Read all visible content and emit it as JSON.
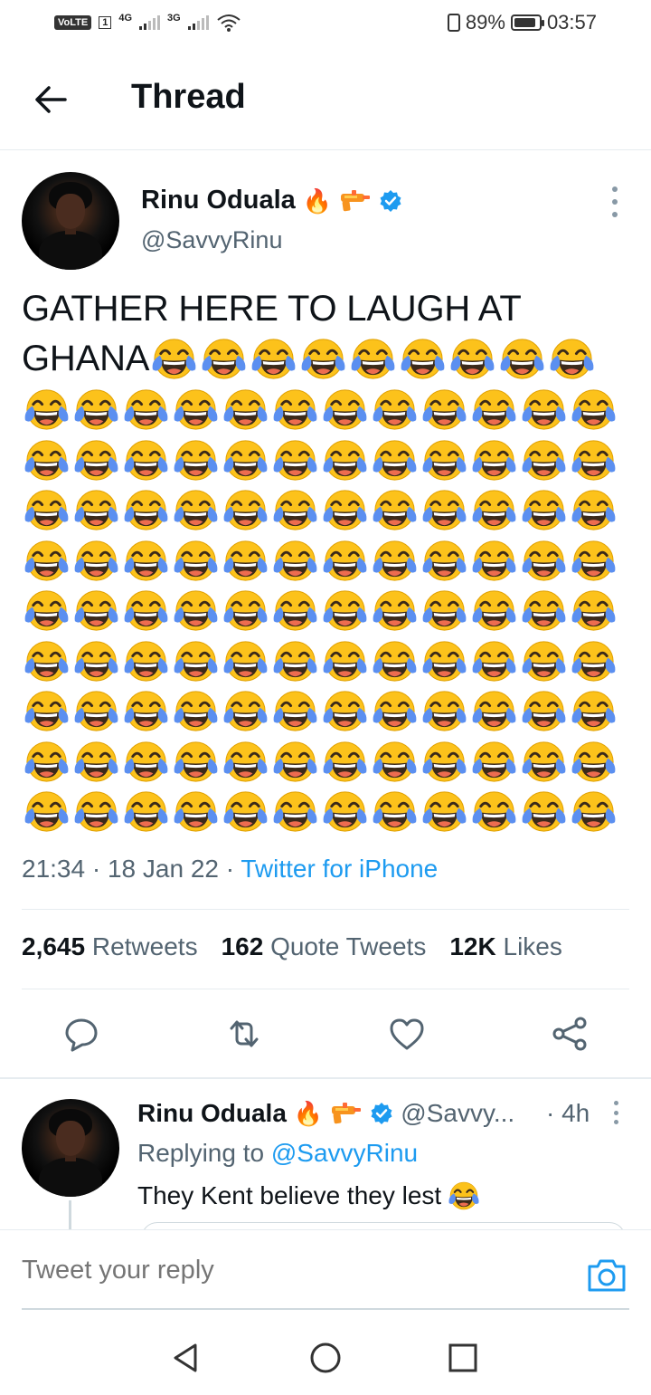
{
  "status_bar": {
    "volte": "VoLTE",
    "sim_slot": "1",
    "net1": "4G",
    "net2": "3G",
    "battery": "89%",
    "time": "03:57"
  },
  "header": {
    "title": "Thread"
  },
  "tweet": {
    "author_name": "Rinu Oduala",
    "author_handle": "@SavvyRinu",
    "name_emojis": [
      "🔥",
      "water-pistol",
      "verified-badge"
    ],
    "text_line1": "GATHER HERE TO LAUGH AT",
    "text_line2": "GHANA",
    "emoji": "😂",
    "emoji_rows": [
      9,
      12,
      12,
      12,
      12,
      12,
      12,
      12,
      12,
      12
    ],
    "time": "21:34",
    "date": "18 Jan 22",
    "source": "Twitter for iPhone",
    "separator": "·",
    "stats": {
      "retweets_count": "2,645",
      "retweets_label": "Retweets",
      "quotes_count": "162",
      "quotes_label": "Quote Tweets",
      "likes_count": "12K",
      "likes_label": "Likes"
    }
  },
  "reply": {
    "author_name": "Rinu Oduala",
    "author_handle": "@Savvy...",
    "time": "· 4h",
    "replying_prefix": "Replying to",
    "replying_to": "@SavvyRinu",
    "text": "They Kent believe they lest",
    "emoji": "😂"
  },
  "composer": {
    "placeholder": "Tweet your reply"
  },
  "colors": {
    "accent": "#1d9bf0",
    "text_primary": "#0f1419",
    "text_secondary": "#536471",
    "divider": "#e6ecf0"
  }
}
